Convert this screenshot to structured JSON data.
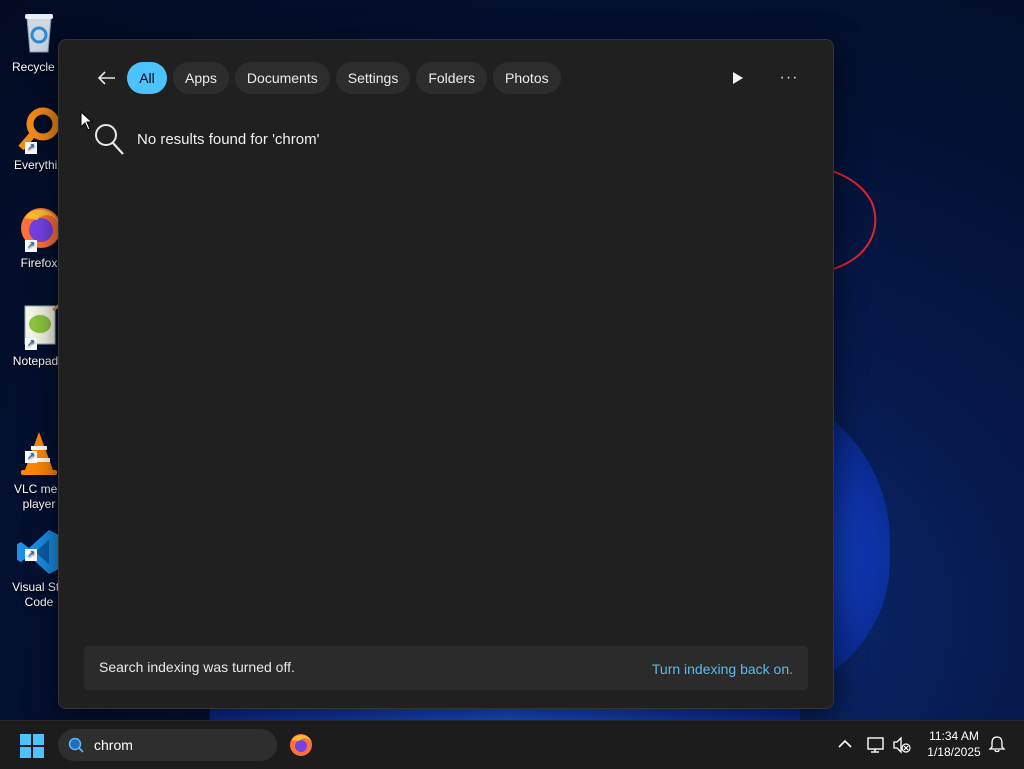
{
  "desktop": {
    "icons": [
      {
        "label": "Recycle B",
        "icon": "recycle-bin-icon"
      },
      {
        "label": "Everythin",
        "icon": "everything-search-icon"
      },
      {
        "label": "Firefox",
        "icon": "firefox-icon"
      },
      {
        "label": "Notepad+",
        "icon": "notepad-plus-plus-icon"
      },
      {
        "label": "VLC med\nplayer",
        "icon": "vlc-icon"
      },
      {
        "label": "Visual Stu\nCode",
        "icon": "vscode-icon"
      }
    ]
  },
  "search_panel": {
    "filters": [
      {
        "label": "All",
        "active": true
      },
      {
        "label": "Apps"
      },
      {
        "label": "Documents"
      },
      {
        "label": "Settings"
      },
      {
        "label": "Folders"
      },
      {
        "label": "Photos"
      }
    ],
    "more_label": "···",
    "no_results_text": "No results found for 'chrom'",
    "indexing": {
      "message": "Search indexing was turned off.",
      "link": "Turn indexing back on."
    }
  },
  "taskbar": {
    "search_query": "chrom",
    "time": "11:34 AM",
    "date": "1/18/2025"
  },
  "colors": {
    "accent": "#4cc2ff",
    "link": "#60b8ef",
    "panel_bg": "#202020",
    "annotation": "#e0242b"
  }
}
